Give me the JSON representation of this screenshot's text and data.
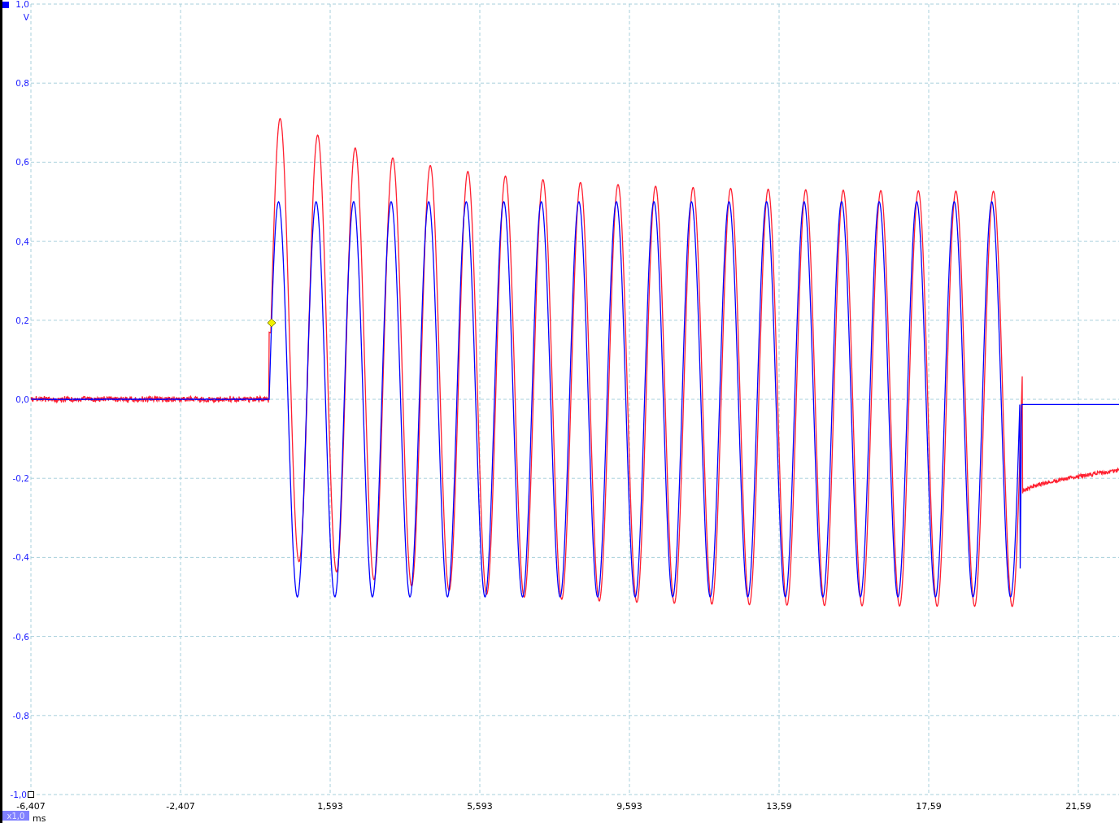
{
  "y_axis": {
    "unit": "V",
    "ticks": [
      "1,0",
      "0,8",
      "0,6",
      "0,4",
      "0,2",
      "0,0",
      "-0,2",
      "-0,4",
      "-0,6",
      "-0,8",
      "-1,0"
    ]
  },
  "x_axis": {
    "unit": "ms",
    "ticks": [
      "-6,407",
      "-2,407",
      "1,593",
      "5,593",
      "9,593",
      "13,59",
      "17,59",
      "21,59"
    ]
  },
  "scale_badge": "x1,0",
  "traces": [
    {
      "color": "#0000ff"
    },
    {
      "color": "#ff2030"
    }
  ]
}
